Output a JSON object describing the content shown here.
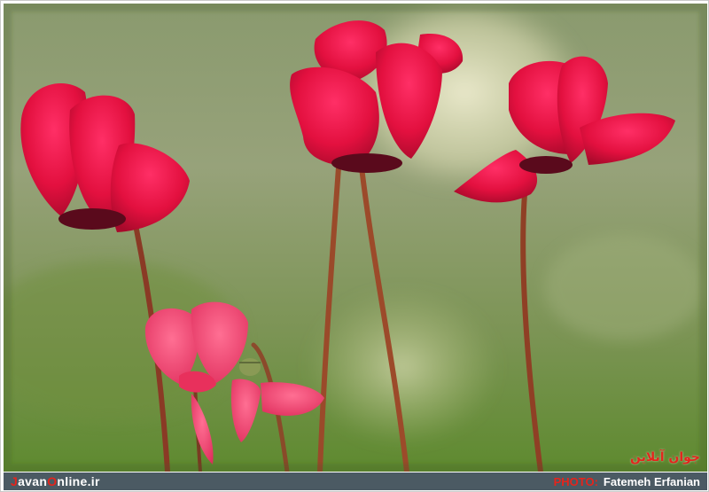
{
  "photo": {
    "watermark_text": "جوان آنلاین"
  },
  "footer": {
    "brand_first_letter": "J",
    "brand_mid1": "avan",
    "brand_o": "O",
    "brand_rest": "nline.ir",
    "credit_label": "PHOTO:",
    "credit_name": "Fatemeh Erfanian"
  },
  "colors": {
    "footer_bg": "#4b5a63",
    "accent_red": "#e5241c",
    "petal_red": "#e8143f"
  }
}
